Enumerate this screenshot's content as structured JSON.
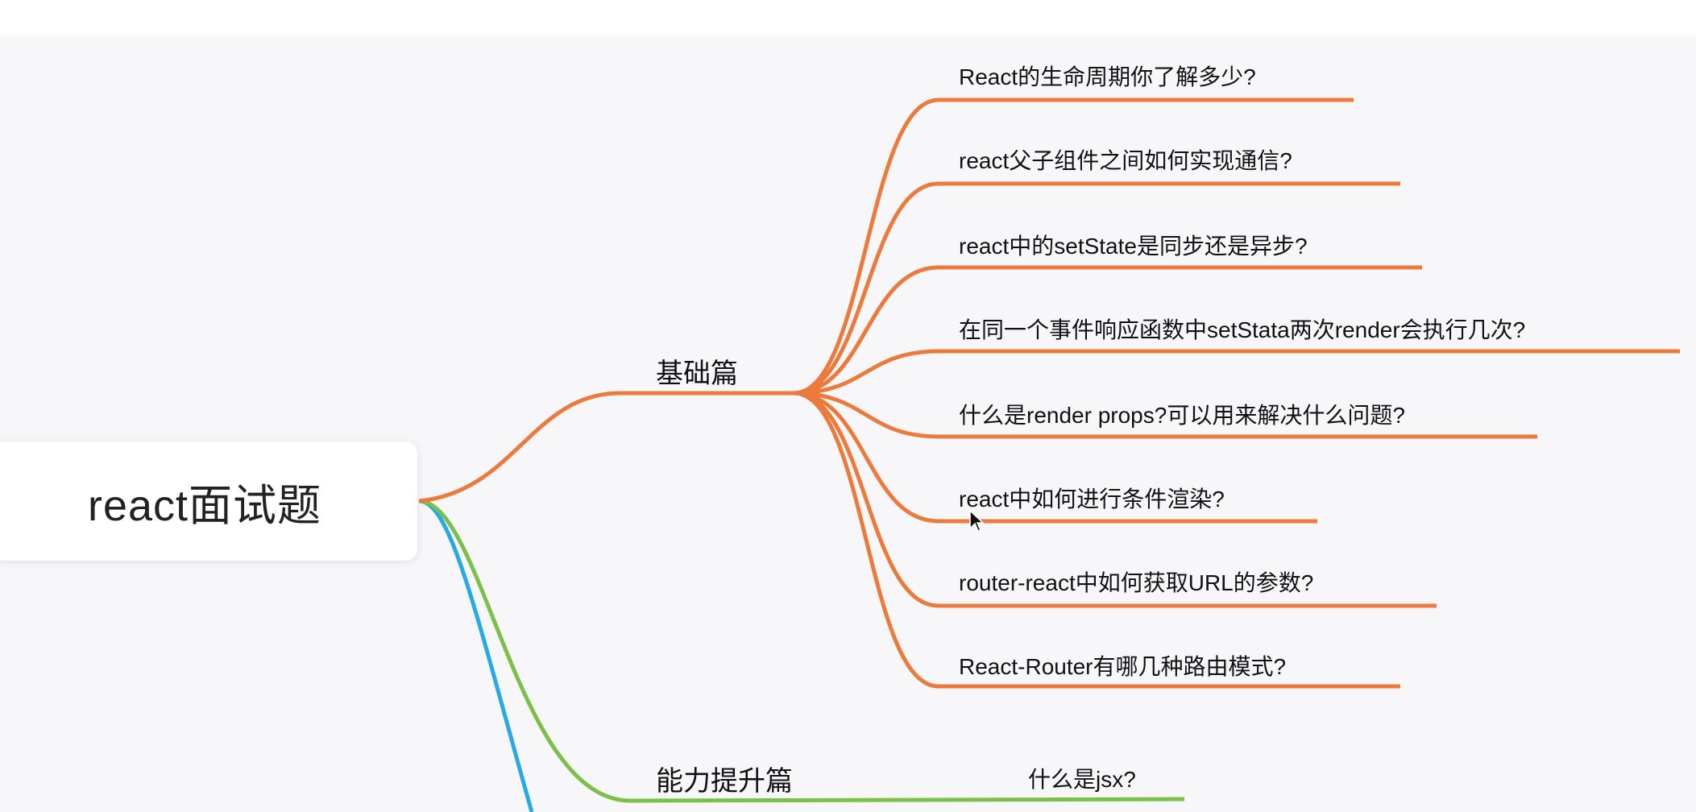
{
  "root": {
    "label": "react面试题"
  },
  "branches": [
    {
      "label": "基础篇",
      "color": "#ec7a3c",
      "items": [
        "React的生命周期你了解多少?",
        "react父子组件之间如何实现通信?",
        "react中的setState是同步还是异步?",
        "在同一个事件响应函数中setStata两次render会执行几次?",
        "什么是render props?可以用来解决什么问题?",
        "react中如何进行条件渲染?",
        "router-react中如何获取URL的参数?",
        "React-Router有哪几种路由模式?"
      ]
    },
    {
      "label": "能力提升篇",
      "color": "#7cc04a",
      "items": [
        "什么是jsx?"
      ]
    },
    {
      "label": "",
      "color": "#27a9e1",
      "items": []
    }
  ],
  "icons": {
    "cursor": "mouse-pointer-icon"
  }
}
